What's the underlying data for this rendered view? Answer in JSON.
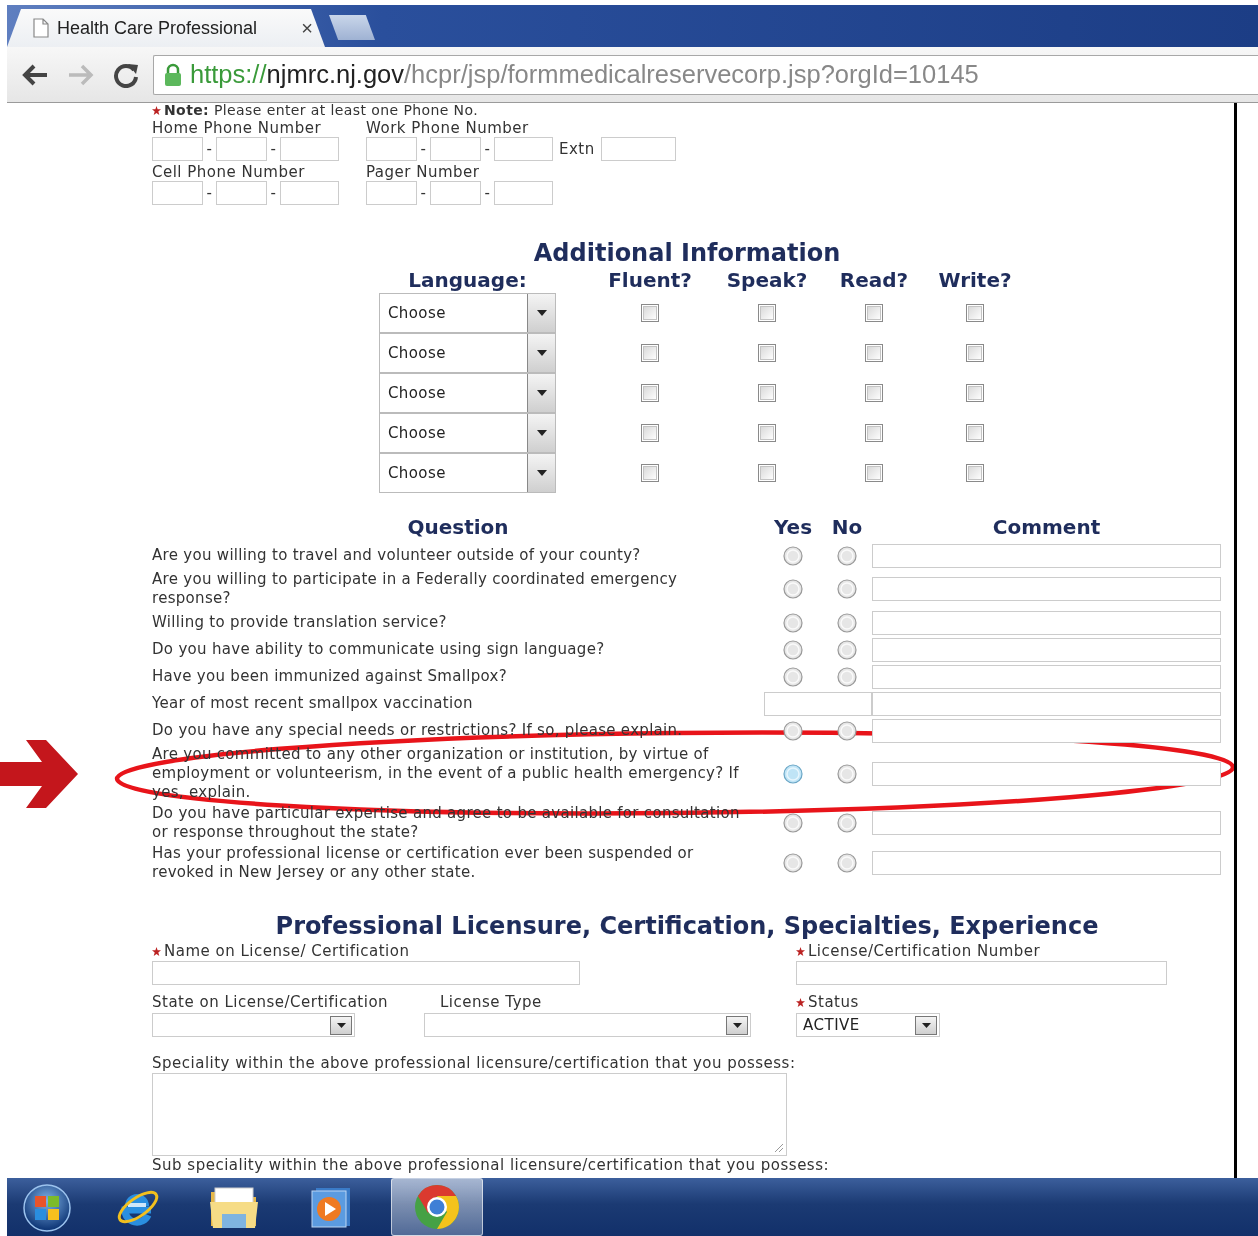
{
  "browser": {
    "tab_title": "Health Care Professional",
    "tab_close": "×",
    "url": "https://njmrc.nj.gov/hcpr/jsp/formmedicalreservecorp.jsp?orgId=10145"
  },
  "phone": {
    "note": "**Note:** Please enter at least one Phone No.",
    "note_required": true,
    "fields": [
      {
        "label": "Home Phone Number",
        "separators": [
          "-",
          "-"
        ]
      },
      {
        "label": "Work Phone Number",
        "separators": [
          "-",
          "-"
        ],
        "extension_label": "Extn"
      },
      {
        "label": "Cell Phone Number",
        "separators": [
          "-",
          "-"
        ]
      },
      {
        "label": "Pager Number",
        "separators": [
          "-",
          "-"
        ]
      }
    ]
  },
  "languages": {
    "title": "Additional Information",
    "headers": [
      "Language:",
      "Fluent?",
      "Speak?",
      "Read?",
      "Write?"
    ],
    "rows": [
      {
        "value": "Choose",
        "fluent": false,
        "speak": false,
        "read": false,
        "write": false
      },
      {
        "value": "Choose",
        "fluent": false,
        "speak": false,
        "read": false,
        "write": false
      },
      {
        "value": "Choose",
        "fluent": false,
        "speak": false,
        "read": false,
        "write": false
      },
      {
        "value": "Choose",
        "fluent": false,
        "speak": false,
        "read": false,
        "write": false
      },
      {
        "value": "Choose",
        "fluent": false,
        "speak": false,
        "read": false,
        "write": false
      }
    ]
  },
  "questions": {
    "headers": [
      "Question",
      "Yes",
      "No",
      "Comment"
    ],
    "rows": [
      {
        "kind": "yes_no",
        "text": "Are you willing to travel and volunteer outside of your county?",
        "yes_selected": false,
        "no_selected": false,
        "yes_hovered": false
      },
      {
        "kind": "yes_no",
        "text": "Are you willing to participate in a Federally coordinated emergency response?",
        "yes_selected": false,
        "no_selected": false,
        "yes_hovered": false
      },
      {
        "kind": "yes_no",
        "text": "Willing to provide translation service?",
        "yes_selected": false,
        "no_selected": false,
        "yes_hovered": false
      },
      {
        "kind": "yes_no",
        "text": "Do you have ability to communicate using sign language?",
        "yes_selected": false,
        "no_selected": false,
        "yes_hovered": false
      },
      {
        "kind": "yes_no",
        "text": "Have you been immunized against Smallpox?",
        "yes_selected": false,
        "no_selected": false,
        "yes_hovered": false
      },
      {
        "kind": "year",
        "text": "Year of most recent smallpox vaccination"
      },
      {
        "kind": "yes_no",
        "text": "Do you have any special needs or restrictions? If so, please explain.",
        "yes_selected": false,
        "no_selected": false,
        "yes_hovered": false
      },
      {
        "kind": "yes_no",
        "text": "Are you committed to any other organization or institution, by virtue of employment or volunteerism, in the event of a public health emergency? If yes, explain.",
        "yes_selected": false,
        "no_selected": false,
        "yes_hovered": true
      },
      {
        "kind": "yes_no",
        "text": "Do you have particular expertise and agree to be available for consultation or response throughout the state?",
        "yes_selected": false,
        "no_selected": false,
        "yes_hovered": false
      },
      {
        "kind": "yes_no",
        "text": "Has your professional license or certification ever been suspended or revoked in New Jersey or any other state.",
        "yes_selected": false,
        "no_selected": false,
        "yes_hovered": false
      }
    ]
  },
  "license": {
    "title": "Professional Licensure, Certification, Specialties, Experience",
    "fields": [
      {
        "kind": "text",
        "label": "Name on License/ Certification",
        "required": true
      },
      {
        "kind": "text",
        "label": "License/Certification Number",
        "required": true
      },
      {
        "kind": "select",
        "label": "State on License/Certification",
        "required": false
      },
      {
        "kind": "select",
        "label": "License Type",
        "required": false
      },
      {
        "kind": "select",
        "label": "Status",
        "required": true,
        "value": "ACTIVE"
      },
      {
        "kind": "textarea",
        "label": "Speciality within the above professional licensure/certification that you possess:",
        "required": false
      },
      {
        "kind": "label",
        "label": "Sub speciality within the above professional licensure/certification that you possess:",
        "required": false
      }
    ]
  },
  "taskbar": {
    "items": [
      {
        "kind": "start",
        "selected": false
      },
      {
        "kind": "e",
        "selected": false
      },
      {
        "kind": "folder",
        "selected": false
      },
      {
        "kind": "media",
        "selected": false
      },
      {
        "kind": "chrome",
        "selected": true
      }
    ]
  }
}
